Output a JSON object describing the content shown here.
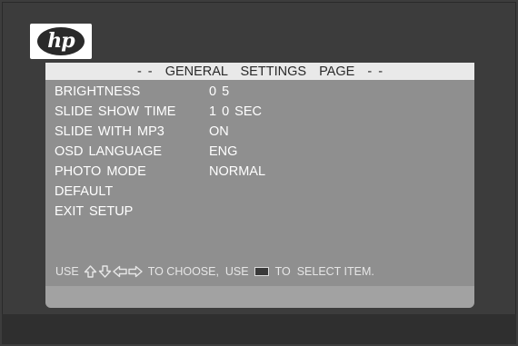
{
  "brand": {
    "logo_text": "hp"
  },
  "settings_page": {
    "title": "- -  GENERAL  SETTINGS  PAGE  - -",
    "items": [
      {
        "label": "BRIGHTNESS",
        "value": "0 5"
      },
      {
        "label": "SLIDE SHOW TIME",
        "value": "1 0 SEC"
      },
      {
        "label": "SLIDE WITH MP3",
        "value": "ON"
      },
      {
        "label": "OSD LANGUAGE",
        "value": "ENG"
      },
      {
        "label": "PHOTO MODE",
        "value": "NORMAL"
      },
      {
        "label": "DEFAULT",
        "value": ""
      },
      {
        "label": "EXIT SETUP",
        "value": ""
      }
    ],
    "hint": {
      "prefix": "USE",
      "arrow_icons": [
        "arrow-up-icon",
        "arrow-down-icon",
        "arrow-left-icon",
        "arrow-right-icon"
      ],
      "middle": "TO CHOOSE,  USE",
      "enter_icon": "enter-key-icon",
      "suffix": "TO  SELECT ITEM."
    }
  },
  "colors": {
    "background": "#3d3d3d",
    "panel": "#8f8f8f",
    "header": "#e9e9e9",
    "text": "#ffffff"
  }
}
